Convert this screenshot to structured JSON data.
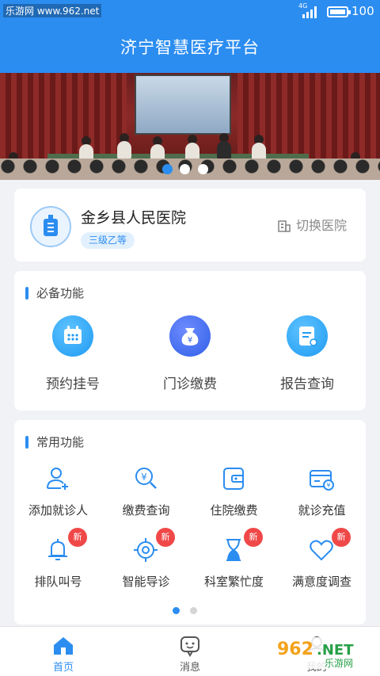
{
  "status_bar": {
    "watermark": "乐游网 www.962.net",
    "network": "4G",
    "battery": "100"
  },
  "header": {
    "title": "济宁智慧医疗平台"
  },
  "banner": {
    "slides": 3,
    "active": 0
  },
  "hospital": {
    "name": "金乡县人民医院",
    "level": "三级乙等",
    "switch_label": "切换医院",
    "logo_icon": "hospital-icon",
    "switch_icon": "building-icon"
  },
  "essential": {
    "title": "必备功能",
    "items": [
      {
        "label": "预约挂号",
        "icon": "calendar-icon"
      },
      {
        "label": "门诊缴费",
        "icon": "money-bag-icon"
      },
      {
        "label": "报告查询",
        "icon": "report-icon"
      }
    ]
  },
  "common": {
    "title": "常用功能",
    "badge": "新",
    "items": [
      {
        "label": "添加就诊人",
        "icon": "add-user-icon",
        "badge": false
      },
      {
        "label": "缴费查询",
        "icon": "payment-search-icon",
        "badge": false
      },
      {
        "label": "住院缴费",
        "icon": "wallet-icon",
        "badge": false
      },
      {
        "label": "就诊充值",
        "icon": "card-recharge-icon",
        "badge": false
      },
      {
        "label": "排队叫号",
        "icon": "bell-icon",
        "badge": true
      },
      {
        "label": "智能导诊",
        "icon": "target-icon",
        "badge": true
      },
      {
        "label": "科室繁忙度",
        "icon": "hourglass-icon",
        "badge": true
      },
      {
        "label": "满意度调查",
        "icon": "heart-icon",
        "badge": true
      }
    ],
    "pages": 2,
    "active_page": 0
  },
  "bottom_nav": {
    "tabs": [
      {
        "label": "首页",
        "icon": "home-icon",
        "active": true
      },
      {
        "label": "消息",
        "icon": "message-icon",
        "active": false
      },
      {
        "label": "我的",
        "icon": "user-icon",
        "active": false
      }
    ]
  },
  "watermark": {
    "text": "962.NET",
    "sub": "乐游网"
  },
  "colors": {
    "primary": "#2b8df0",
    "badge": "#f04848",
    "background": "#f0f2f5"
  }
}
